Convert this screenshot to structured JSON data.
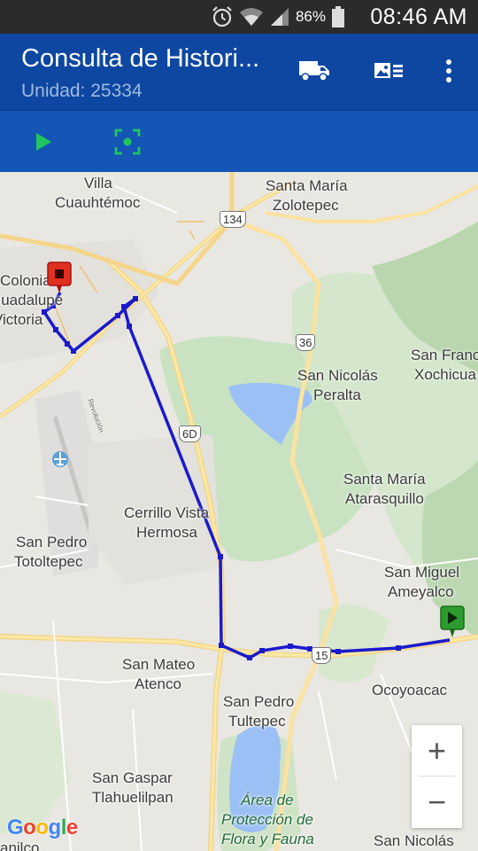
{
  "status_bar": {
    "battery_percent": "86%",
    "time": "08:46 AM",
    "icons": [
      "alarm-icon",
      "wifi-icon",
      "cell-signal-icon",
      "battery-icon"
    ]
  },
  "app_bar": {
    "title": "Consulta de Histori...",
    "subtitle": "Unidad: 25334",
    "actions": [
      "truck-icon",
      "image-list-icon",
      "overflow-menu-icon"
    ]
  },
  "toolbar": {
    "actions": [
      "play-icon",
      "focus-frame-icon"
    ],
    "accent": "#22c55e"
  },
  "map": {
    "labels": {
      "villa_cuauhtemoc_1": "Villa",
      "villa_cuauhtemoc_2": "Cuauhtémoc",
      "santa_maria_zolotepec_1": "Santa María",
      "santa_maria_zolotepec_2": "Zolotepec",
      "colonia_1": "Colonia",
      "colonia_2": "Guadalupe",
      "colonia_3": "Victoria",
      "revolucion": "Revolución",
      "san_nicolas_peralta_1": "San Nicolás",
      "san_nicolas_peralta_2": "Peralta",
      "san_francisco_1": "San Franc",
      "san_francisco_2": "Xochicua",
      "santa_maria_atarasquillo_1": "Santa María",
      "santa_maria_atarasquillo_2": "Atarasquillo",
      "cerrillo_1": "Cerrillo Vista",
      "cerrillo_2": "Hermosa",
      "san_pedro_totoltepec_1": "San Pedro",
      "san_pedro_totoltepec_2": "Totoltepec",
      "san_miguel_ameyalco_1": "San Miguel",
      "san_miguel_ameyalco_2": "Ameyalco",
      "san_mateo_atenco_1": "San Mateo",
      "san_mateo_atenco_2": "Atenco",
      "ocoyoacac": "Ocoyoacac",
      "san_pedro_tultepec_1": "San Pedro",
      "san_pedro_tultepec_2": "Tultepec",
      "san_gaspar_1": "San Gaspar",
      "san_gaspar_2": "Tlahuelilpan",
      "area_proteccion_1": "Área de",
      "area_proteccion_2": "Protección de",
      "area_proteccion_3": "Flora y Fauna",
      "san_nicolas_bottom": "San Nicolás",
      "anilco": "anilco"
    },
    "highways": {
      "h134": "134",
      "h36": "36",
      "h6d": "6D",
      "h15": "15"
    },
    "route_color": "#1a1acc",
    "start_marker_color": "#2e9b2e",
    "end_marker_color": "#e03020",
    "zoom_in": "+",
    "zoom_out": "−",
    "attribution": "Google"
  }
}
